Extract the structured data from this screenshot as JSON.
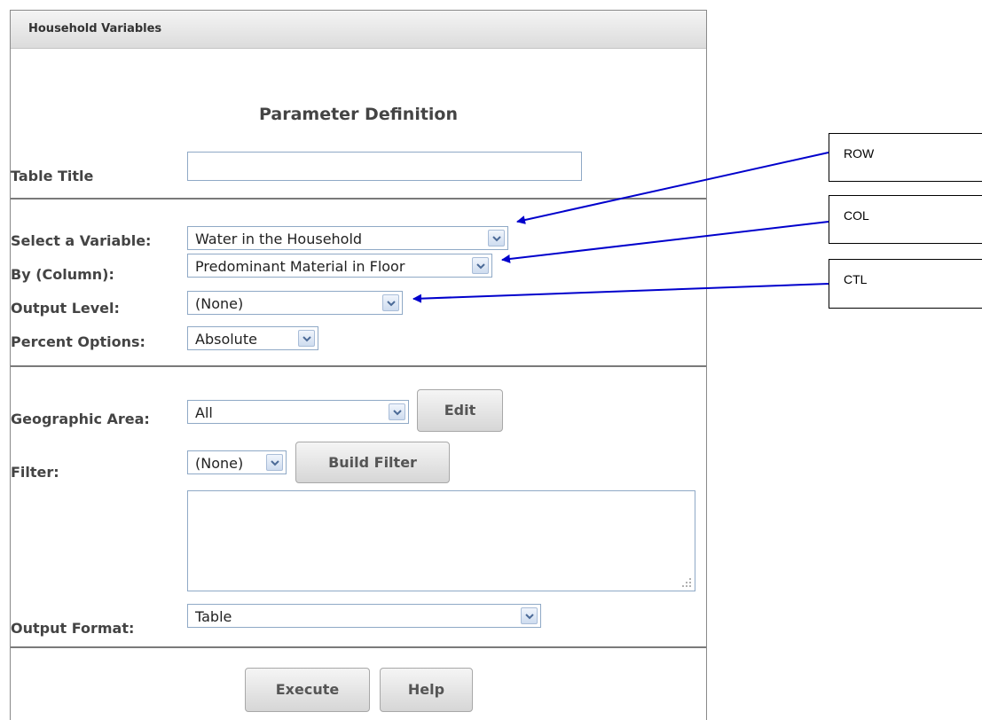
{
  "panel": {
    "header_title": "Household Variables"
  },
  "section_title": "Parameter Definition",
  "form": {
    "table_title_label": "Table Title",
    "table_title_value": "",
    "variable_label": "Select a Variable:",
    "variable_value": "Water in the Household",
    "column_label": "By (Column):",
    "column_value": "Predominant Material in Floor",
    "output_level_label": "Output Level:",
    "output_level_value": "(None)",
    "percent_label": "Percent Options:",
    "percent_value": "Absolute",
    "geo_label": "Geographic Area:",
    "geo_value": "All",
    "edit_button": "Edit",
    "filter_label": "Filter:",
    "filter_value": "(None)",
    "build_filter_button": "Build Filter",
    "filter_text": "",
    "output_format_label": "Output Format:",
    "output_format_value": "Table",
    "execute_button": "Execute",
    "help_button": "Help"
  },
  "annotations": {
    "row": "ROW",
    "col": "COL",
    "ctl": "CTL"
  },
  "colors": {
    "arrow": "#0000cc",
    "input_border": "#8fa9c6",
    "divider": "#7a7a7a"
  }
}
